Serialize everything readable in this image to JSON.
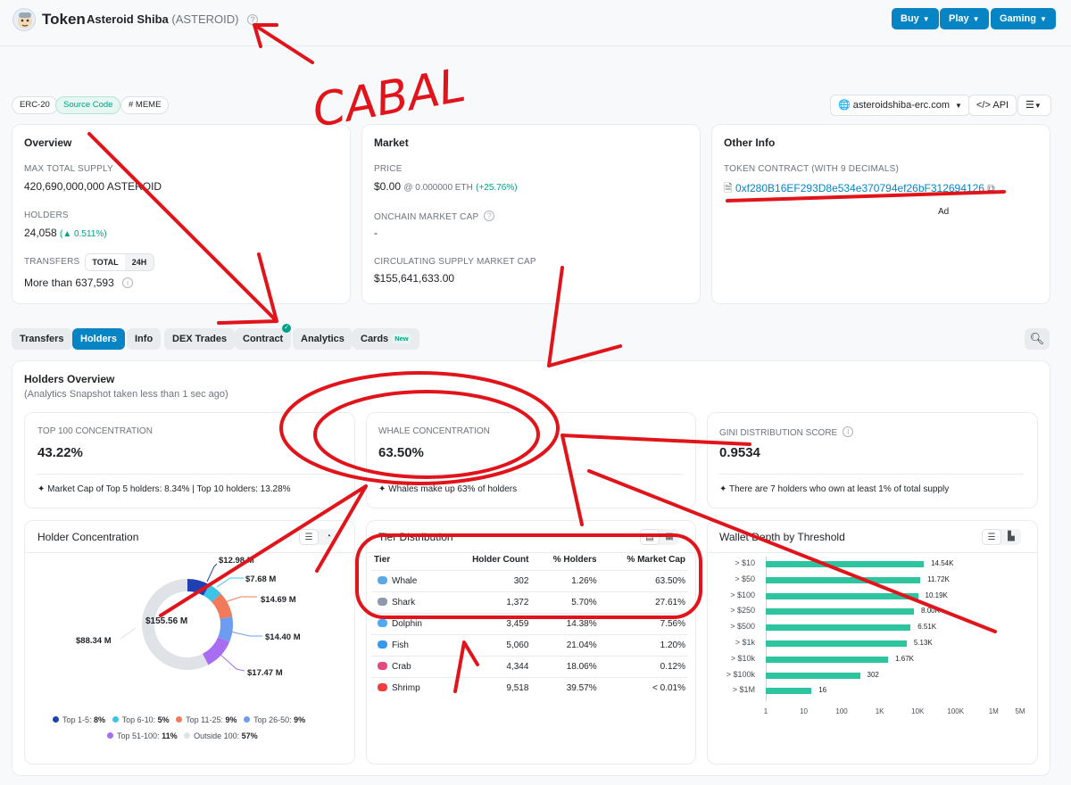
{
  "header": {
    "page_type": "Token",
    "token_name": "Asteroid Shiba",
    "token_symbol": "(ASTEROID)",
    "buttons": [
      {
        "label": "Buy"
      },
      {
        "label": "Play"
      },
      {
        "label": "Gaming"
      }
    ]
  },
  "tags": {
    "erc": "ERC-20",
    "source": "Source Code",
    "meme": "# MEME"
  },
  "actions": {
    "site": "asteroidshiba-erc.com",
    "api": "API"
  },
  "overview": {
    "title": "Overview",
    "max_supply_label": "MAX TOTAL SUPPLY",
    "max_supply_value": "420,690,000,000 ASTEROID",
    "holders_label": "HOLDERS",
    "holders_value": "24,058",
    "holders_change": "(▲ 0.511%)",
    "transfers_label": "TRANSFERS",
    "transfers_toggle": [
      "TOTAL",
      "24H"
    ],
    "transfers_value": "More than 637,593"
  },
  "market": {
    "title": "Market",
    "price_label": "PRICE",
    "price_value": "$0.00",
    "price_eth": "@ 0.000000 ETH",
    "price_change": "(+25.76%)",
    "onchain_label": "ONCHAIN MARKET CAP",
    "onchain_value": "-",
    "circ_label": "CIRCULATING SUPPLY MARKET CAP",
    "circ_value": "$155,641,633.00"
  },
  "other_info": {
    "title": "Other Info",
    "contract_label": "TOKEN CONTRACT (WITH 9 DECIMALS)",
    "contract_address": "0xf280B16EF293D8e534e370794ef26bF312694126",
    "ad_label": "Ad"
  },
  "tabs": [
    {
      "label": "Transfers"
    },
    {
      "label": "Holders"
    },
    {
      "label": "Info"
    },
    {
      "label": "DEX Trades"
    },
    {
      "label": "Contract"
    },
    {
      "label": "Analytics"
    },
    {
      "label": "Cards",
      "badge": "New"
    }
  ],
  "holders_overview": {
    "title": "Holders Overview",
    "subtitle": "(Analytics Snapshot taken less than 1 sec ago)",
    "metrics": [
      {
        "label": "TOP 100 CONCENTRATION",
        "value": "43.22%",
        "sub": "Market Cap of Top 5 holders: 8.34% | Top 10 holders: 13.28%"
      },
      {
        "label": "WHALE CONCENTRATION",
        "value": "63.50%",
        "sub": "Whales make up 63% of holders"
      },
      {
        "label": "GINI DISTRIBUTION SCORE",
        "value": "0.9534",
        "sub": "There are 7 holders who own at least 1% of total supply"
      }
    ]
  },
  "holder_concentration": {
    "title": "Holder Concentration",
    "center": "$155.56 M",
    "slices": [
      {
        "label": "$12.98 M"
      },
      {
        "label": "$7.68 M"
      },
      {
        "label": "$14.69 M"
      },
      {
        "label": "$14.40 M"
      },
      {
        "label": "$17.47 M"
      },
      {
        "label": "$88.34 M"
      }
    ],
    "legend": [
      {
        "name": "Top 1-5:",
        "pct": "8%",
        "color": "#1f3fb3"
      },
      {
        "name": "Top 6-10:",
        "pct": "5%",
        "color": "#3cc4e8"
      },
      {
        "name": "Top 11-25:",
        "pct": "9%",
        "color": "#f07a5a"
      },
      {
        "name": "Top 26-50:",
        "pct": "9%",
        "color": "#6d9cf0"
      },
      {
        "name": "Top 51-100:",
        "pct": "11%",
        "color": "#a86df0"
      },
      {
        "name": "Outside 100:",
        "pct": "57%",
        "color": "#dfe3e8"
      }
    ]
  },
  "tier_distribution": {
    "title": "Tier Distribution",
    "columns": [
      "Tier",
      "Holder Count",
      "% Holders",
      "% Market Cap"
    ],
    "rows": [
      {
        "tier": "Whale",
        "count": "302",
        "holders": "1.26%",
        "mcap": "63.50%",
        "icon": "whale-icon",
        "color": "#5aa9e6"
      },
      {
        "tier": "Shark",
        "count": "1,372",
        "holders": "5.70%",
        "mcap": "27.61%",
        "icon": "shark-icon",
        "color": "#8d99ae"
      },
      {
        "tier": "Dolphin",
        "count": "3,459",
        "holders": "14.38%",
        "mcap": "7.56%",
        "icon": "dolphin-icon",
        "color": "#4dabf7"
      },
      {
        "tier": "Fish",
        "count": "5,060",
        "holders": "21.04%",
        "mcap": "1.20%",
        "icon": "fish-icon",
        "color": "#339af0"
      },
      {
        "tier": "Crab",
        "count": "4,344",
        "holders": "18.06%",
        "mcap": "0.12%",
        "icon": "crab-icon",
        "color": "#e64980"
      },
      {
        "tier": "Shrimp",
        "count": "9,518",
        "holders": "39.57%",
        "mcap": "< 0.01%",
        "icon": "shrimp-icon",
        "color": "#f03e3e"
      }
    ]
  },
  "wallet_depth": {
    "title": "Wallet Depth by Threshold"
  },
  "annotation": {
    "text": "CABAL"
  },
  "chart_data": {
    "type": "bar",
    "orientation": "horizontal",
    "log_scale": true,
    "categories": [
      "> $10",
      "> $50",
      "> $100",
      "> $250",
      "> $500",
      "> $1k",
      "> $10k",
      "> $100k",
      "> $1M"
    ],
    "values": [
      14540,
      11720,
      10190,
      8000,
      6510,
      5130,
      1670,
      302,
      16
    ],
    "value_labels": [
      "14.54K",
      "11.72K",
      "10.19K",
      "8.00K",
      "6.51K",
      "5.13K",
      "1.67K",
      "302",
      "16"
    ],
    "x_ticks": [
      "1",
      "10",
      "100",
      "1K",
      "10K",
      "100K",
      "1M",
      "5M"
    ],
    "xlim": [
      1,
      5000000
    ],
    "color": "#2ec4a0"
  }
}
